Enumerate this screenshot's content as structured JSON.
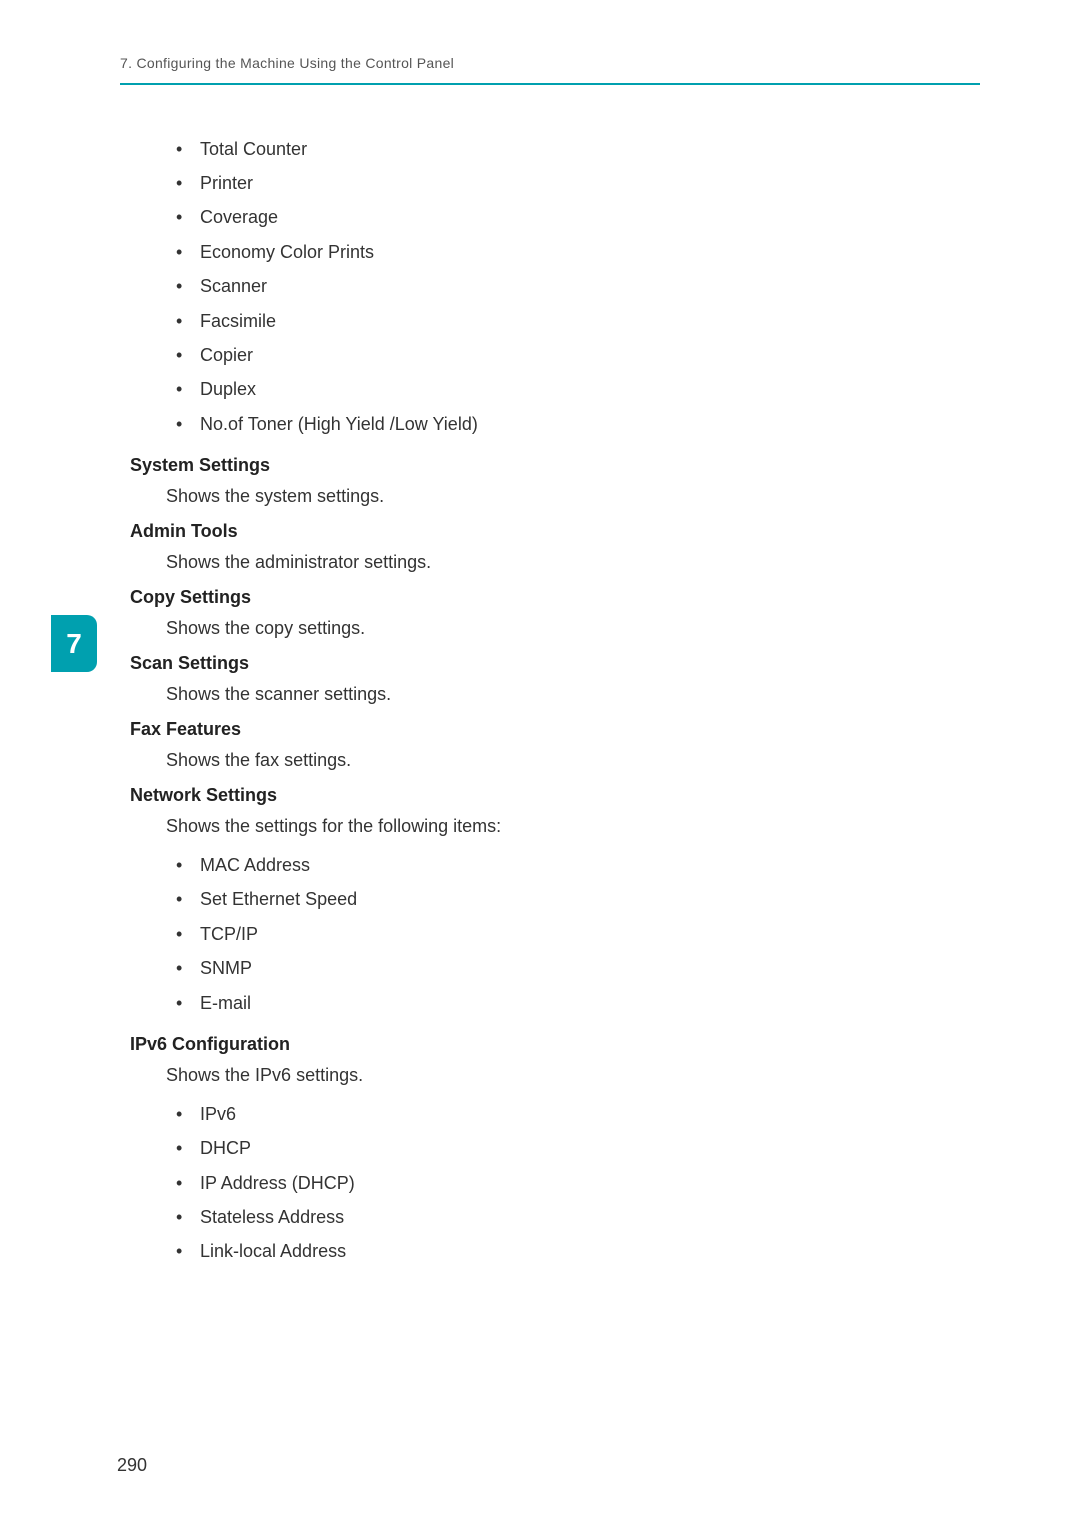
{
  "header": {
    "chapter_title": "7. Configuring the Machine Using the Control Panel"
  },
  "chapter_tab": {
    "number": "7"
  },
  "top_list": {
    "items": [
      "Total Counter",
      "Printer",
      "Coverage",
      "Economy Color Prints",
      "Scanner",
      "Facsimile",
      "Copier",
      "Duplex",
      "No.of Toner (High Yield /Low Yield)"
    ]
  },
  "sections": [
    {
      "heading": "System Settings",
      "description": "Shows the system settings."
    },
    {
      "heading": "Admin Tools",
      "description": "Shows the administrator settings."
    },
    {
      "heading": "Copy Settings",
      "description": "Shows the copy settings."
    },
    {
      "heading": "Scan Settings",
      "description": "Shows the scanner settings."
    },
    {
      "heading": "Fax Features",
      "description": "Shows the fax settings."
    },
    {
      "heading": "Network Settings",
      "description": "Shows the settings for the following items:",
      "items": [
        "MAC Address",
        "Set Ethernet Speed",
        "TCP/IP",
        "SNMP",
        "E-mail"
      ]
    },
    {
      "heading": "IPv6 Configuration",
      "description": "Shows the IPv6 settings.",
      "items": [
        "IPv6",
        "DHCP",
        "IP Address (DHCP)",
        "Stateless Address",
        "Link-local Address"
      ]
    }
  ],
  "page_number": "290"
}
